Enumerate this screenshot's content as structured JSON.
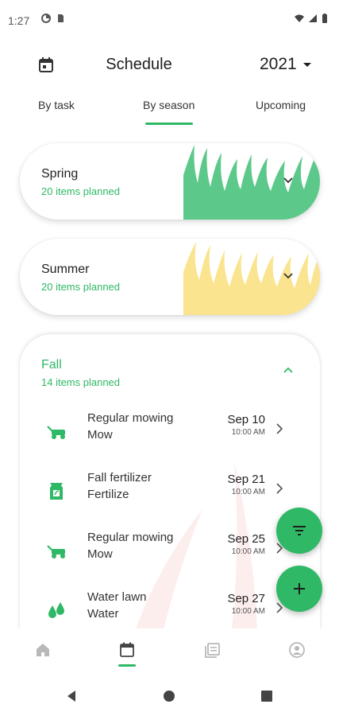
{
  "status_bar": {
    "time": "1:27",
    "left_icons": [
      "data-saver-icon",
      "sim-card-icon"
    ],
    "right_icons": [
      "wifi-icon",
      "cell-signal-icon",
      "battery-icon"
    ]
  },
  "header": {
    "title": "Schedule",
    "year": "2021",
    "calendar_icon": "calendar-icon"
  },
  "tabs": [
    {
      "label": "By task",
      "active": false
    },
    {
      "label": "By season",
      "active": true
    },
    {
      "label": "Upcoming",
      "active": false
    }
  ],
  "seasons": [
    {
      "name": "Spring",
      "count": "20 items planned",
      "color": "#5cc98a",
      "expanded": false
    },
    {
      "name": "Summer",
      "count": "20 items planned",
      "color": "#fbe48f",
      "expanded": false
    }
  ],
  "fall": {
    "name": "Fall",
    "count": "14 items planned",
    "expanded": true,
    "tasks": [
      {
        "title": "Regular mowing",
        "type": "Mow",
        "date": "Sep 10",
        "time": "10:00 AM",
        "icon": "lawn-mower-icon"
      },
      {
        "title": "Fall fertilizer",
        "type": "Fertilize",
        "date": "Sep 21",
        "time": "10:00 AM",
        "icon": "fertilizer-bag-icon"
      },
      {
        "title": "Regular mowing",
        "type": "Mow",
        "date": "Sep 25",
        "time": "10:00 AM",
        "icon": "lawn-mower-icon"
      },
      {
        "title": "Water lawn",
        "type": "Water",
        "date": "Sep 27",
        "time": "10:00 AM",
        "icon": "water-drops-icon"
      }
    ]
  },
  "fabs": {
    "filter_icon": "filter-icon",
    "add_icon": "add-icon"
  },
  "bottom_nav": [
    {
      "icon": "home-icon",
      "active": false
    },
    {
      "icon": "calendar-icon",
      "active": true
    },
    {
      "icon": "library-icon",
      "active": false
    },
    {
      "icon": "account-icon",
      "active": false
    }
  ],
  "colors": {
    "accent": "#2fb865",
    "spring": "#5cc98a",
    "summer": "#fbe48f",
    "inactive_icon": "#b8b8b8"
  }
}
